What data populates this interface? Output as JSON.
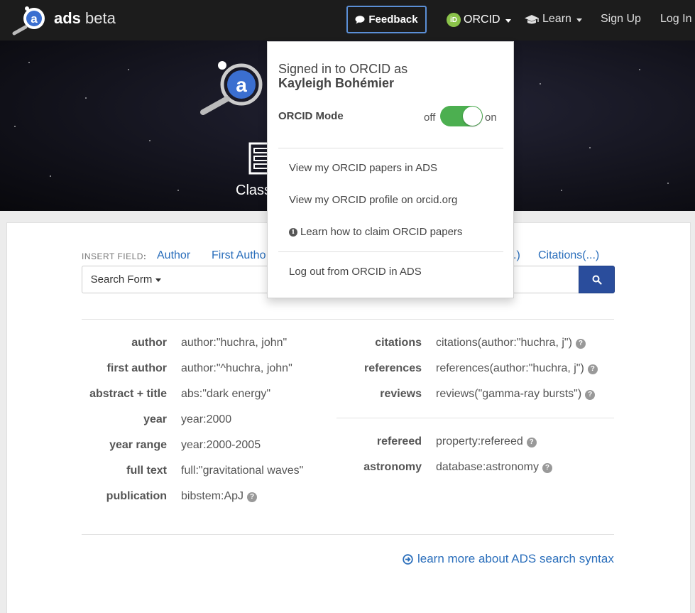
{
  "navbar": {
    "brand_bold": "ads",
    "brand_light": "beta",
    "feedback_label": "Feedback",
    "orcid_badge": "iD",
    "orcid_label": "ORCID",
    "learn_label": "Learn",
    "signup_label": "Sign Up",
    "login_label": "Log In"
  },
  "hero": {
    "classic_label": "Class"
  },
  "insert": {
    "label": "INSERT FIELD",
    "colon": ":",
    "fields": [
      "Author",
      "First Autho",
      ".)",
      "Citations(...)"
    ]
  },
  "search": {
    "form_label": "Search Form",
    "placeholder": ""
  },
  "examples": {
    "left": [
      {
        "label": "author",
        "value": "author:\"huchra, john\""
      },
      {
        "label": "first author",
        "value": "author:\"^huchra, john\""
      },
      {
        "label": "abstract + title",
        "value": "abs:\"dark energy\""
      },
      {
        "label": "year",
        "value": "year:2000"
      },
      {
        "label": "year range",
        "value": "year:2000-2005"
      },
      {
        "label": "full text",
        "value": "full:\"gravitational waves\""
      },
      {
        "label": "publication",
        "value": "bibstem:ApJ"
      }
    ],
    "right": [
      {
        "label": "citations",
        "value": "citations(author:\"huchra, j\")"
      },
      {
        "label": "references",
        "value": "references(author:\"huchra, j\")"
      },
      {
        "label": "reviews",
        "value": "reviews(\"gamma-ray bursts\")"
      },
      {
        "label": "refereed",
        "value": "property:refereed"
      },
      {
        "label": "astronomy",
        "value": "database:astronomy"
      }
    ],
    "help_glyph": "?"
  },
  "learn_more": "learn more about ADS search syntax",
  "orcid_dropdown": {
    "signed_in_text": "Signed in to ORCID as",
    "user_name": "Kayleigh Bohémier",
    "mode_label": "ORCID Mode",
    "off_label": "off",
    "on_label": "on",
    "mode_on": true,
    "items": [
      "View my ORCID papers in ADS",
      "View my ORCID profile on orcid.org",
      "Learn how to claim ORCID papers",
      "Log out from ORCID in ADS"
    ],
    "info_glyph": "i"
  },
  "colors": {
    "navbar_bg": "#1c1c1c",
    "link_blue": "#2a6ebb",
    "search_btn": "#2a4d9c",
    "toggle_on": "#4caf50",
    "orcid_green": "#8bc34a"
  }
}
